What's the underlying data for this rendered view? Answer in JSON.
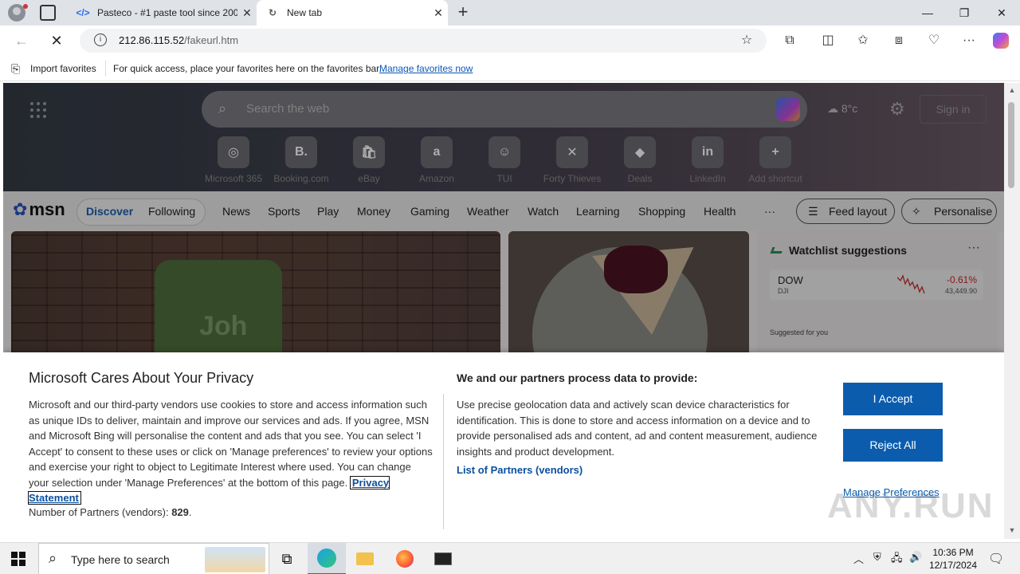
{
  "browser": {
    "tabs": [
      {
        "label": "Pasteco - #1 paste tool since 200",
        "icon": "pasteco-icon"
      },
      {
        "label": "New tab",
        "icon": "loading-icon"
      }
    ],
    "address": {
      "host": "212.86.115.52",
      "path": "/fakeurl.htm"
    },
    "favorites_bar": {
      "import_label": "Import favorites",
      "message": "For quick access, place your favorites here on the favorites bar.",
      "manage_link": "Manage favorites now"
    }
  },
  "newtab": {
    "search_placeholder": "Search the web",
    "weather": "8°c",
    "sign_in": "Sign in",
    "shortcuts": [
      {
        "label": "Microsoft 365",
        "glyph": "◎"
      },
      {
        "label": "Booking.com",
        "glyph": "B."
      },
      {
        "label": "eBay",
        "glyph": "🛍"
      },
      {
        "label": "Amazon",
        "glyph": "a"
      },
      {
        "label": "TUI",
        "glyph": "☺"
      },
      {
        "label": "Forty Thieves",
        "glyph": "✕"
      },
      {
        "label": "Deals",
        "glyph": "◆"
      },
      {
        "label": "LinkedIn",
        "glyph": "in"
      },
      {
        "label": "Add shortcut",
        "glyph": "+"
      }
    ]
  },
  "msn": {
    "logo": "msn",
    "pills": [
      "Discover",
      "Following"
    ],
    "nav": [
      "News",
      "Sports",
      "Play",
      "Money",
      "Gaming",
      "Weather",
      "Watch",
      "Learning",
      "Shopping",
      "Health"
    ],
    "more": "···",
    "feed_layout": "Feed layout",
    "personalise": "Personalise",
    "card_sign_text": "Joh",
    "watchlist": {
      "title": "Watchlist suggestions",
      "stock": {
        "symbol": "DOW",
        "sub": "DJI",
        "change": "-0.61%",
        "price": "43,449.90"
      },
      "suggested": "Suggested for you"
    }
  },
  "privacy": {
    "title": "Microsoft Cares About Your Privacy",
    "body": "Microsoft and our third-party vendors use cookies to store and access information such as unique IDs to deliver, maintain and improve our services and ads. If you agree, MSN and Microsoft Bing will personalise the content and ads that you see. You can select 'I Accept' to consent to these uses or click on 'Manage preferences' to review your options and exercise your right to object to Legitimate Interest where used.  You can change your selection under 'Manage Preferences' at the bottom of this page.",
    "privacy_link": "Privacy Statement",
    "vendors_label": "Number of Partners (vendors):",
    "vendors_count": "829",
    "right_title": "We and our partners process data to provide:",
    "right_body": "Use precise geolocation data and actively scan device characteristics for identification. This is done to store and access information on a device and to provide personalised ads and content, ad and content measurement, audience insights and product development.",
    "partners_link": "List of Partners (vendors)",
    "accept": "I Accept",
    "reject": "Reject All",
    "manage": "Manage Preferences"
  },
  "watermark": "ANY.RUN",
  "taskbar": {
    "search_placeholder": "Type here to search",
    "time": "10:36 PM",
    "date": "12/17/2024"
  },
  "colors": {
    "accent": "#0b5cad",
    "link": "#0b57b8",
    "negative": "#c62828"
  }
}
